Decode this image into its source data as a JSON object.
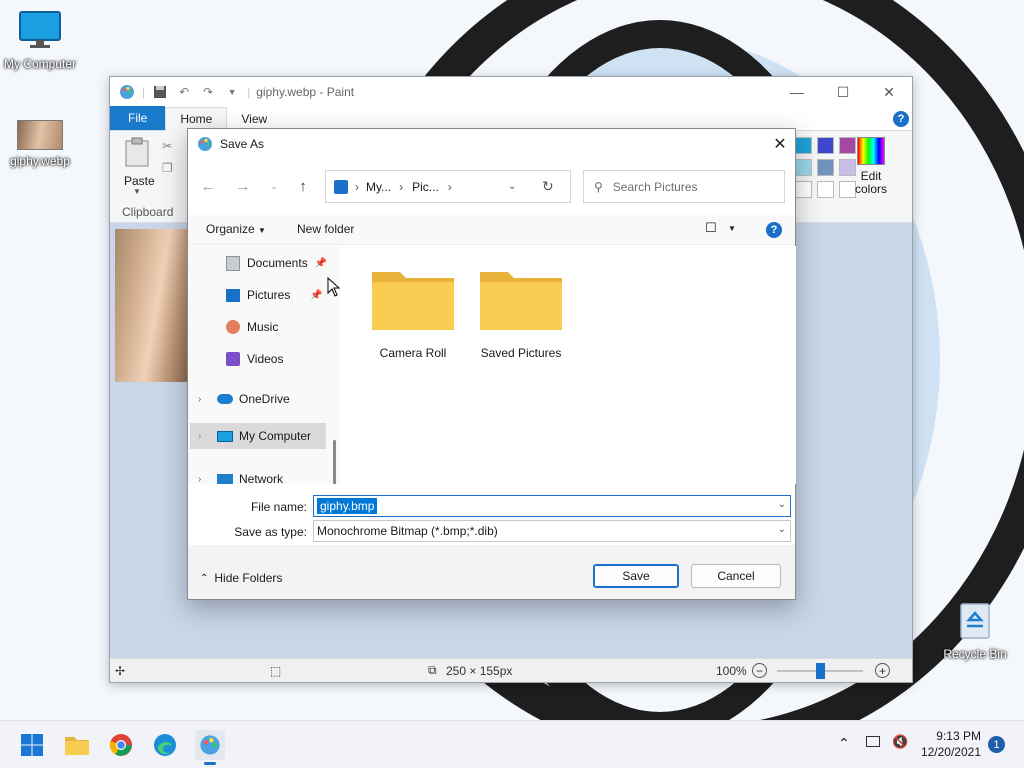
{
  "desktop": {
    "icons": [
      {
        "label": "My Computer"
      },
      {
        "label": "giphy.webp"
      },
      {
        "label": "Recycle Bin"
      }
    ]
  },
  "paint": {
    "title": "giphy.webp - Paint",
    "tabs": [
      "File",
      "Home",
      "View"
    ],
    "ribbon": {
      "paste_label": "Paste",
      "clipboard_label": "Clipboard",
      "edit_colors_label_1": "Edit",
      "edit_colors_label_2": "colors"
    },
    "palette": [
      "#1ea3d9",
      "#3f48cc",
      "#a349a4",
      "#99d9ea",
      "#7092be",
      "#c8bfe7",
      "#ffffff",
      "#ffffff",
      "#ffffff"
    ],
    "status": {
      "dimensions": "250 × 155px",
      "zoom": "100%",
      "zoom_slider_level": 0.5
    }
  },
  "dialog": {
    "title": "Save As",
    "address": {
      "part1": "My...",
      "part2": "Pic..."
    },
    "search_placeholder": "Search Pictures",
    "organize_label": "Organize",
    "new_folder_label": "New folder",
    "nav": [
      {
        "label": "Documents",
        "pinned": true
      },
      {
        "label": "Pictures",
        "pinned": true
      },
      {
        "label": "Music",
        "pinned": false
      },
      {
        "label": "Videos",
        "pinned": false
      },
      {
        "label": "OneDrive",
        "pinned": false
      },
      {
        "label": "My Computer",
        "pinned": false,
        "selected": true
      },
      {
        "label": "Network",
        "pinned": false
      }
    ],
    "folders": [
      {
        "label": "Camera Roll"
      },
      {
        "label": "Saved Pictures"
      }
    ],
    "file_name_label": "File name:",
    "file_name_value": "giphy.bmp",
    "save_type_label": "Save as type:",
    "save_type_value": "Monochrome Bitmap (*.bmp;*.dib)",
    "hide_folders_label": "Hide Folders",
    "save_label": "Save",
    "cancel_label": "Cancel"
  },
  "taskbar": {
    "time": "9:13 PM",
    "date": "12/20/2021",
    "notification_count": "1"
  },
  "colors": {
    "accent": "#1a6fc9",
    "file_tab": "#1979ca",
    "folder": "#f5c842"
  }
}
